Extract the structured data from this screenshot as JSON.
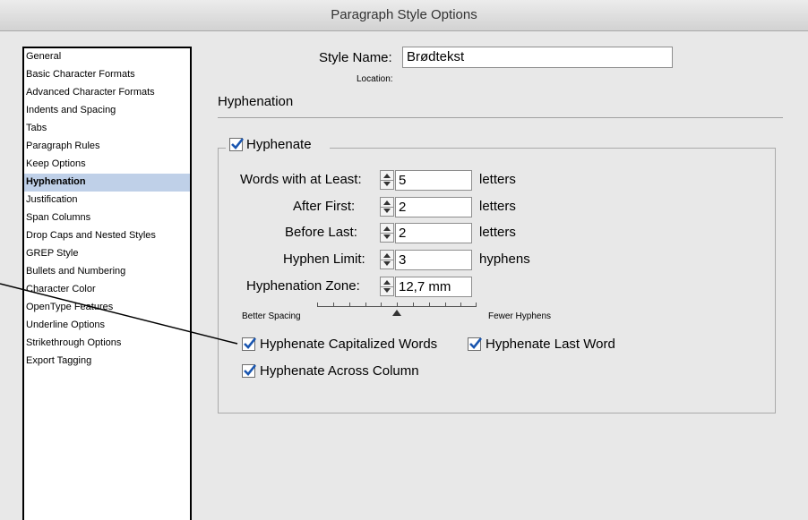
{
  "window": {
    "title": "Paragraph Style Options"
  },
  "sidebar": {
    "items": [
      {
        "label": "General"
      },
      {
        "label": "Basic Character Formats"
      },
      {
        "label": "Advanced Character Formats"
      },
      {
        "label": "Indents and Spacing"
      },
      {
        "label": "Tabs"
      },
      {
        "label": "Paragraph Rules"
      },
      {
        "label": "Keep Options"
      },
      {
        "label": "Hyphenation",
        "selected": true
      },
      {
        "label": "Justification"
      },
      {
        "label": "Span Columns"
      },
      {
        "label": "Drop Caps and Nested Styles"
      },
      {
        "label": "GREP Style"
      },
      {
        "label": "Bullets and Numbering"
      },
      {
        "label": "Character Color"
      },
      {
        "label": "OpenType Features"
      },
      {
        "label": "Underline Options"
      },
      {
        "label": "Strikethrough Options"
      },
      {
        "label": "Export Tagging"
      }
    ]
  },
  "header": {
    "style_name_label": "Style Name:",
    "style_name_value": "Brødtekst",
    "location_label": "Location:"
  },
  "section": {
    "title": "Hyphenation"
  },
  "hyphenate": {
    "label": "Hyphenate",
    "checked": true,
    "fields": {
      "words_label": "Words with at Least:",
      "words_value": "5",
      "words_unit": "letters",
      "after_label": "After First:",
      "after_value": "2",
      "after_unit": "letters",
      "before_label": "Before Last:",
      "before_value": "2",
      "before_unit": "letters",
      "limit_label": "Hyphen Limit:",
      "limit_value": "3",
      "limit_unit": "hyphens",
      "zone_label": "Hyphenation Zone:",
      "zone_value": "12,7 mm"
    },
    "slider": {
      "left_label": "Better Spacing",
      "right_label": "Fewer Hyphens",
      "position": 0.5
    },
    "options": {
      "capitalized_label": "Hyphenate Capitalized Words",
      "capitalized_checked": true,
      "last_word_label": "Hyphenate Last Word",
      "last_word_checked": true,
      "across_column_label": "Hyphenate Across Column",
      "across_column_checked": true
    }
  }
}
